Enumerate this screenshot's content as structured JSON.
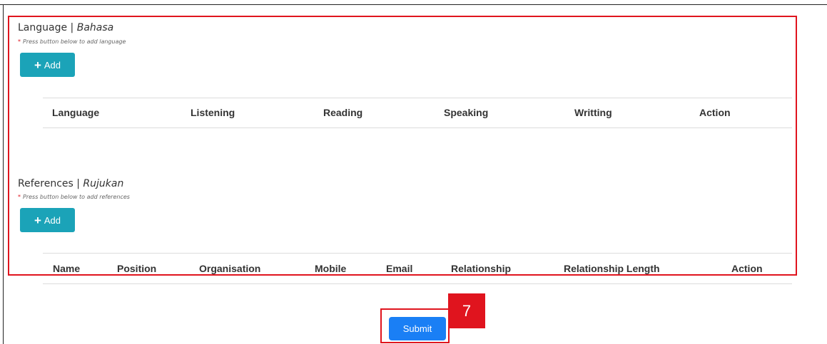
{
  "language_section": {
    "title": "Language | ",
    "title_italic": "Bahasa",
    "hint_star": "*",
    "hint": "Press button below to add language",
    "add_icon": "plus-icon",
    "add_label": "Add",
    "columns": [
      "Language",
      "Listening",
      "Reading",
      "Speaking",
      "Writting",
      "Action"
    ]
  },
  "references_section": {
    "title": "References | ",
    "title_italic": "Rujukan",
    "hint_star": "*",
    "hint": "Press button below to add references",
    "add_icon": "plus-icon",
    "add_label": "Add",
    "columns": [
      "Name",
      "Position",
      "Organisation",
      "Mobile",
      "Email",
      "Relationship",
      "Relationship Length",
      "Action"
    ]
  },
  "footer": {
    "submit_label": "Submit",
    "step_badge": "7"
  },
  "colors": {
    "highlight": "#e0141e",
    "add_button": "#1ba3b8",
    "submit_button": "#1a7ff5"
  }
}
